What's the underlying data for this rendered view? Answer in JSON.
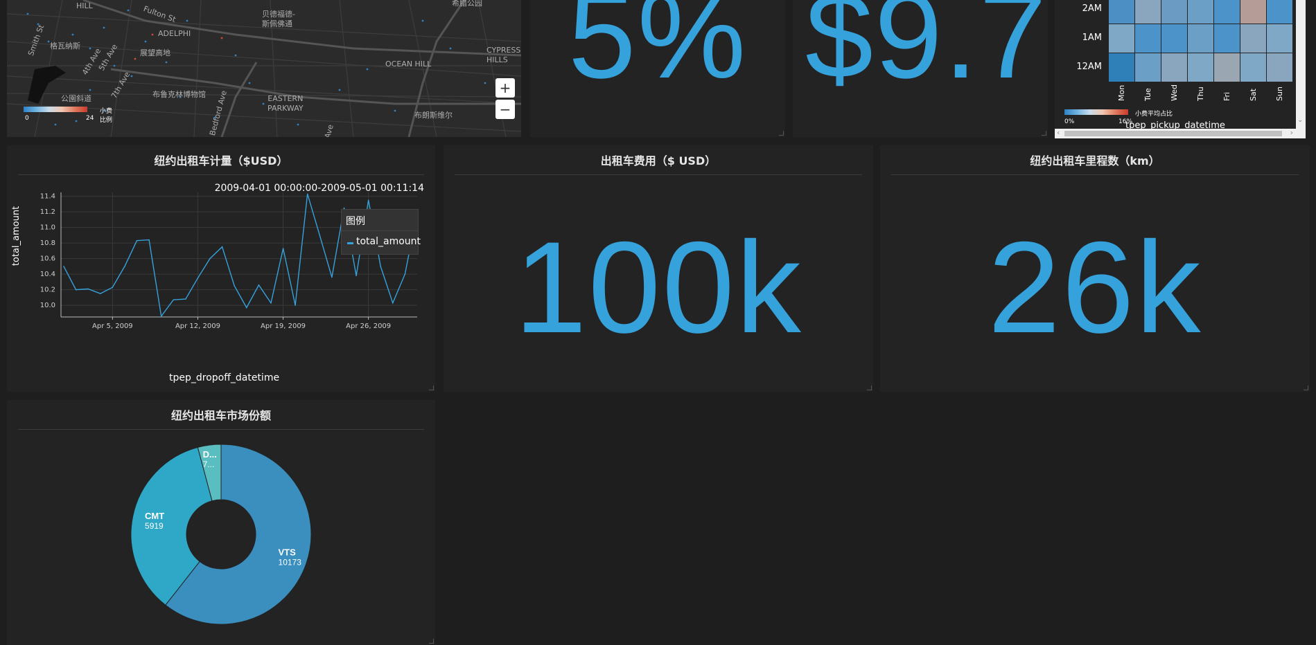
{
  "map": {
    "labels": {
      "hill": "HILL",
      "fulton": "Fulton St",
      "bedstuy": "贝德福德-\n斯佩佛通",
      "greenwood": "格瓦纳斯",
      "adelphi": "ADELPHI",
      "prospect_heights": "展望高地",
      "ocean_hill": "OCEAN HILL",
      "cypress": "CYPRESS\nHILLS",
      "smith": "Smith St",
      "fourth_ave": "4th Ave",
      "fifth_ave": "5th Ave",
      "seventh_ave": "7th Ave",
      "crown": "布鲁克林博物馆",
      "bedford": "Bedford Ave",
      "eastern": "EASTERN\nPARKWAY",
      "park": "公園斜道",
      "brownsville": "布朗斯维尔",
      "ave": "Ave",
      "top_right": "希腊公园"
    },
    "legend_title": "小费比例",
    "legend_min": "0",
    "legend_max": "24",
    "zoom_in": "+",
    "zoom_out": "−"
  },
  "kpi_tip_pct": {
    "value": "5%"
  },
  "kpi_avg_fare": {
    "value": "$9.7"
  },
  "heatmap": {
    "rows": [
      "2AM",
      "1AM",
      "12AM"
    ],
    "cols": [
      "Mon",
      "Tue",
      "Wed",
      "Thu",
      "Fri",
      "Sat",
      "Sun"
    ],
    "cells": [
      [
        "#4c8fc4",
        "#8aa6bf",
        "#6b9ac2",
        "#6b9fc6",
        "#4c93c9",
        "#b59c97",
        "#4c93c9"
      ],
      [
        "#7fa7c6",
        "#4c93c9",
        "#4c93c9",
        "#6b9fc6",
        "#4c93c9",
        "#8aa6bf",
        "#7fa7c6"
      ],
      [
        "#2f7fb9",
        "#6b9fc6",
        "#8aa6bf",
        "#7fa7c6",
        "#9aa7b2",
        "#7fa7c6",
        "#8aa6bf"
      ]
    ],
    "legend_title": "小费平均占比",
    "legend_min": "0%",
    "legend_max": "16%",
    "xaxis_label": "tpep_pickup_datetime"
  },
  "line_panel": {
    "title": "纽约出租车计量（$USD）",
    "range_text": "2009-04-01 00:00:00-2009-05-01 00:11:14",
    "legend_title": "图例",
    "legend_item": "total_amount"
  },
  "fare_panel": {
    "title": "出租车费用（$ USD）",
    "value": "100k"
  },
  "distance_panel": {
    "title": "纽约出租车里程数（km）",
    "value": "26k"
  },
  "pie_panel": {
    "title": "纽约出租车市场份额"
  },
  "colors": {
    "accent": "#36a2dc",
    "panel": "#232323",
    "background": "#1e1e1e"
  },
  "chart_data": [
    {
      "type": "line",
      "xlabel": "tpep_dropoff_datetime",
      "ylabel": "total_amount",
      "x_ticks": [
        "Apr 5, 2009",
        "Apr 12, 2009",
        "Apr 19, 2009",
        "Apr 26, 2009"
      ],
      "y_ticks": [
        "10.0",
        "10.2",
        "10.4",
        "10.6",
        "10.8",
        "11.0",
        "11.2",
        "11.4"
      ],
      "ylim": [
        9.85,
        11.45
      ],
      "x": [
        "2009-04-01",
        "2009-04-02",
        "2009-04-03",
        "2009-04-04",
        "2009-04-05",
        "2009-04-06",
        "2009-04-07",
        "2009-04-08",
        "2009-04-09",
        "2009-04-10",
        "2009-04-11",
        "2009-04-12",
        "2009-04-13",
        "2009-04-14",
        "2009-04-15",
        "2009-04-16",
        "2009-04-17",
        "2009-04-18",
        "2009-04-19",
        "2009-04-20",
        "2009-04-21",
        "2009-04-22",
        "2009-04-23",
        "2009-04-24",
        "2009-04-25",
        "2009-04-26",
        "2009-04-27",
        "2009-04-28",
        "2009-04-29",
        "2009-04-30"
      ],
      "series": [
        {
          "name": "total_amount",
          "values": [
            10.5,
            10.2,
            10.21,
            10.15,
            10.23,
            10.5,
            10.83,
            10.84,
            9.86,
            10.07,
            10.08,
            10.35,
            10.6,
            10.75,
            10.25,
            9.97,
            10.26,
            10.03,
            10.73,
            10.0,
            11.43,
            10.9,
            10.36,
            11.25,
            10.38,
            11.35,
            10.5,
            10.03,
            10.4,
            11.2
          ],
          "color": "#36a2dc"
        }
      ],
      "grid": true,
      "legend_position": "top-right"
    },
    {
      "type": "pie",
      "donut": true,
      "labels": [
        "VTS",
        "CMT",
        "DDS"
      ],
      "display_labels": [
        "VTS",
        "CMT",
        "D..."
      ],
      "display_values": [
        "10173",
        "5919",
        "7..."
      ],
      "values": [
        10173,
        5919,
        700
      ],
      "colors": [
        "#3a8fbf",
        "#2fa8c8",
        "#5abdbf"
      ]
    }
  ]
}
